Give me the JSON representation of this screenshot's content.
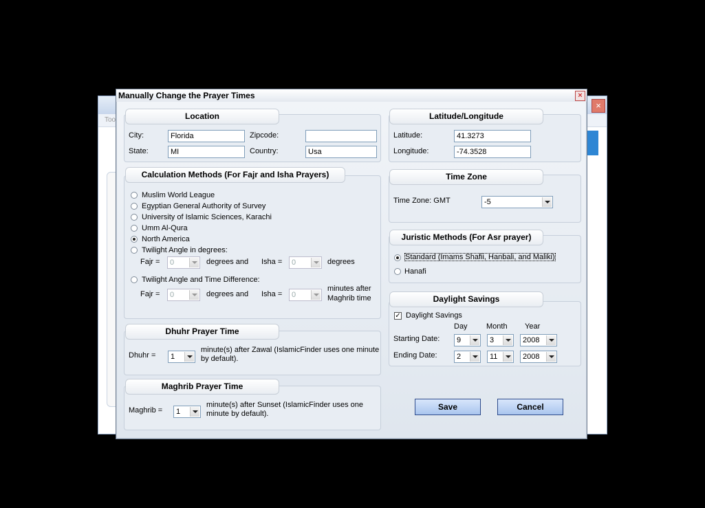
{
  "background_window": {
    "menu_text": "Too"
  },
  "dialog": {
    "title": "Manually Change the Prayer Times",
    "close_glyph": "×"
  },
  "location": {
    "title": "Location",
    "city_label": "City:",
    "city_value": "Florida",
    "zipcode_label": "Zipcode:",
    "zipcode_value": "",
    "state_label": "State:",
    "state_value": "MI",
    "country_label": "Country:",
    "country_value": "Usa"
  },
  "latlon": {
    "title": "Latitude/Longitude",
    "lat_label": "Latitude:",
    "lat_value": "41.3273",
    "lon_label": "Longitude:",
    "lon_value": "-74.3528"
  },
  "calc": {
    "title": "Calculation Methods (For Fajr and Isha Prayers)",
    "options": [
      "Muslim World League",
      "Egyptian General Authority of Survey",
      "University of Islamic Sciences, Karachi",
      "Umm Al-Qura",
      "North America",
      "Twilight Angle in degrees:"
    ],
    "selected": "North America",
    "angle": {
      "fajr_label": "Fajr =",
      "fajr_value": "0",
      "degrees_and": "degrees and",
      "isha_label": "Isha =",
      "isha_value": "0",
      "degrees": "degrees"
    },
    "timediff_option": "Twilight Angle and Time Difference:",
    "timediff": {
      "fajr_label": "Fajr =",
      "fajr_value": "0",
      "degrees_and": "degrees and",
      "isha_label": "Isha =",
      "isha_value": "0",
      "minutes_after": "minutes after",
      "maghrib_time": "Maghrib time"
    }
  },
  "timezone": {
    "title": "Time Zone",
    "label": "Time Zone: GMT",
    "value": "-5"
  },
  "juristic": {
    "title": "Juristic Methods (For Asr prayer)",
    "standard": "Standard (Imams Shafii, Hanbali, and Maliki)",
    "hanafi": "Hanafi",
    "selected": "Standard (Imams Shafii, Hanbali, and Maliki)"
  },
  "daylight": {
    "title": "Daylight Savings",
    "checkbox_label": "Daylight Savings",
    "checked": true,
    "check_glyph": "✓",
    "day_header": "Day",
    "month_header": "Month",
    "year_header": "Year",
    "start_label": "Starting Date:",
    "start_day": "9",
    "start_month": "3",
    "start_year": "2008",
    "end_label": "Ending Date:",
    "end_day": "2",
    "end_month": "11",
    "end_year": "2008"
  },
  "dhuhr": {
    "title": "Dhuhr Prayer Time",
    "label": "Dhuhr =",
    "value": "1",
    "note1": "minute(s) after Zawal  (IslamicFinder uses one minute",
    "note2": "by default)."
  },
  "maghrib": {
    "title": "Maghrib Prayer Time",
    "label": "Maghrib =",
    "value": "1",
    "note1": "minute(s) after Sunset (IslamicFinder uses one",
    "note2": "minute by default)."
  },
  "buttons": {
    "save": "Save",
    "cancel": "Cancel"
  }
}
